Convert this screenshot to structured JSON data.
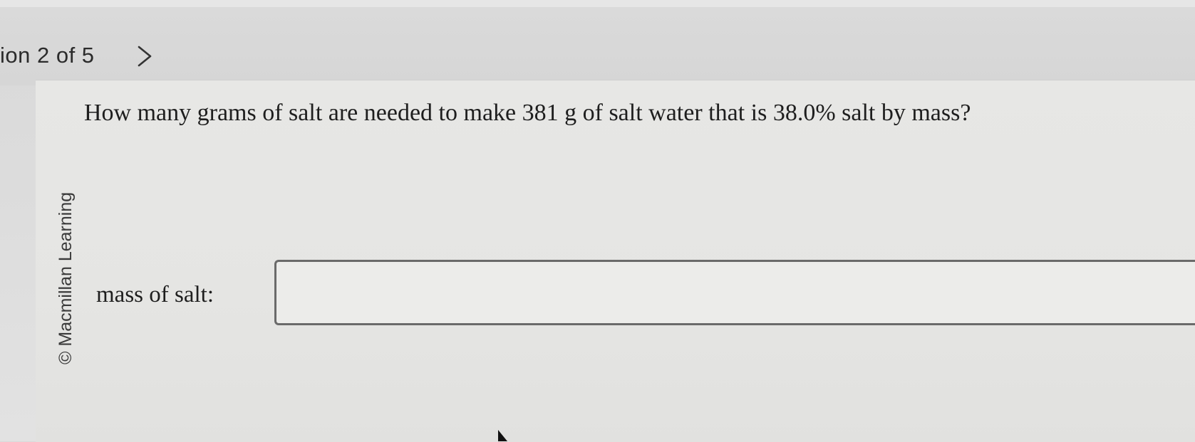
{
  "nav": {
    "counter_text": "ion 2 of 5",
    "next_icon": "chevron-right-icon"
  },
  "sidebar": {
    "copyright": "© Macmillan Learning"
  },
  "question": {
    "text": "How many grams of salt are needed to make 381 g of salt water that is 38.0% salt by mass?",
    "answer_label": "mass of salt:",
    "answer_value": ""
  },
  "colors": {
    "background": "#d9d9d9",
    "panel": "#e6e6e4",
    "text": "#1e1e1e",
    "input_border": "#6a6a6a"
  }
}
